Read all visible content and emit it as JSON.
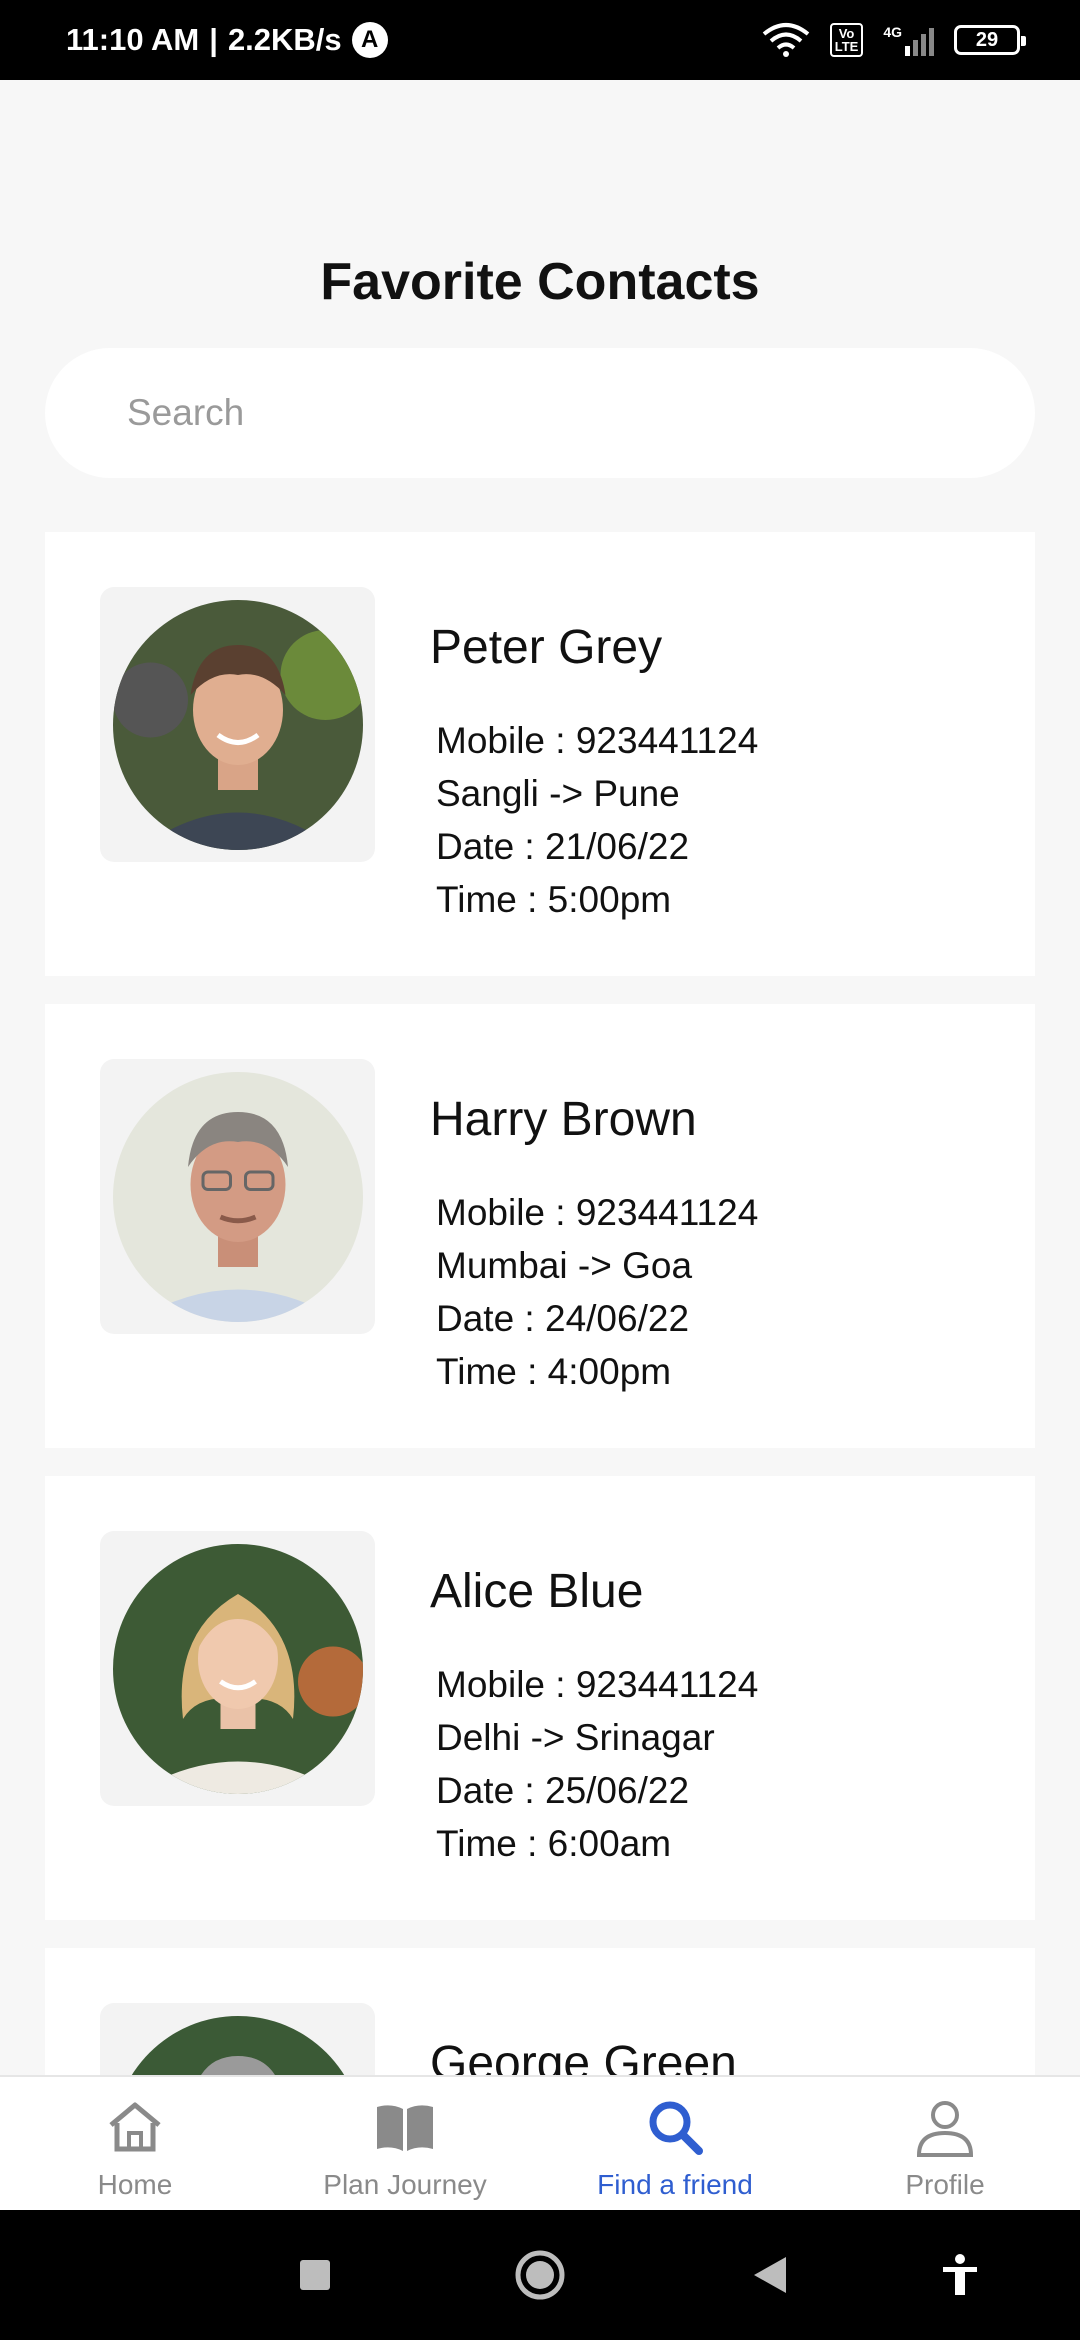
{
  "status_bar": {
    "time": "11:10 AM",
    "net_speed": "2.2KB/s",
    "notif_icon_letter": "A",
    "volte_label": "Vo\nLTE",
    "network_type": "4G",
    "battery_level": "29"
  },
  "page": {
    "title": "Favorite Contacts"
  },
  "search": {
    "placeholder": "Search",
    "value": ""
  },
  "contacts": [
    {
      "name": "Peter Grey",
      "mobile": "Mobile : 923441124",
      "route": "Sangli -> Pune",
      "date": "Date : 21/06/22",
      "time": "Time : 5:00pm"
    },
    {
      "name": "Harry Brown",
      "mobile": "Mobile : 923441124",
      "route": "Mumbai -> Goa",
      "date": "Date : 24/06/22",
      "time": "Time : 4:00pm"
    },
    {
      "name": "Alice Blue",
      "mobile": "Mobile : 923441124",
      "route": "Delhi -> Srinagar",
      "date": "Date : 25/06/22",
      "time": "Time : 6:00am"
    },
    {
      "name": "George Green",
      "mobile": "",
      "route": "",
      "date": "",
      "time": ""
    }
  ],
  "bottom_nav": {
    "items": [
      {
        "label": "Home",
        "icon": "home-icon",
        "active": false
      },
      {
        "label": "Plan Journey",
        "icon": "book-icon",
        "active": false
      },
      {
        "label": "Find a friend",
        "icon": "search-icon",
        "active": true
      },
      {
        "label": "Profile",
        "icon": "user-icon",
        "active": false
      }
    ],
    "active_color": "#2f5ed0",
    "inactive_color": "#8a8a8a"
  },
  "system_nav": {
    "buttons": [
      "recents-icon",
      "home-circle-icon",
      "back-icon",
      "accessibility-icon"
    ]
  }
}
